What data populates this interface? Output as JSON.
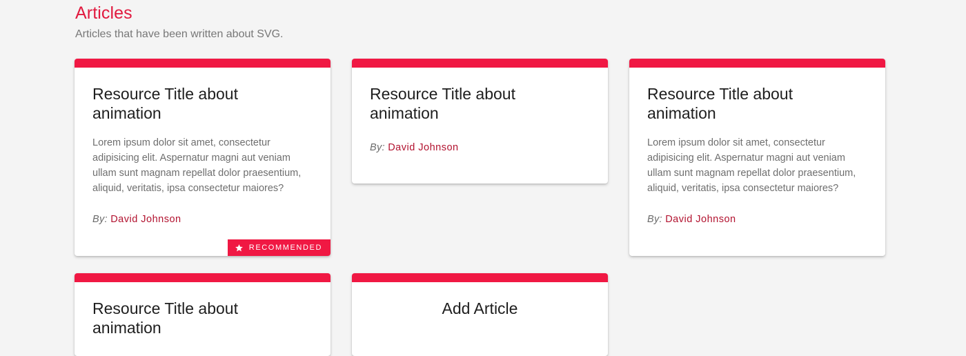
{
  "section": {
    "title": "Articles",
    "subtitle": "Articles that have been written about SVG."
  },
  "colors": {
    "accent": "#f01843",
    "title": "#e11a3f",
    "author": "#b2122f",
    "background": "#f4f4f4"
  },
  "cards": [
    {
      "title": "Resource Title about animation",
      "description": "Lorem ipsum dolor sit amet, consectetur adipisicing elit. Aspernatur magni aut veniam ullam sunt magnam repellat dolor praesentium, aliquid, veritatis, ipsa consectetur maiores?",
      "by_label": "By:",
      "author": "David Johnson",
      "badge": "RECOMMENDED",
      "badge_icon": "star-icon"
    },
    {
      "title": "Resource Title about animation",
      "by_label": "By:",
      "author": "David Johnson"
    },
    {
      "title": "Resource Title about animation",
      "description": "Lorem ipsum dolor sit amet, consectetur adipisicing elit. Aspernatur magni aut veniam ullam sunt magnam repellat dolor praesentium, aliquid, veritatis, ipsa consectetur maiores?",
      "by_label": "By:",
      "author": "David Johnson"
    },
    {
      "title": "Resource Title about animation"
    }
  ],
  "add_card": {
    "title": "Add Article"
  }
}
